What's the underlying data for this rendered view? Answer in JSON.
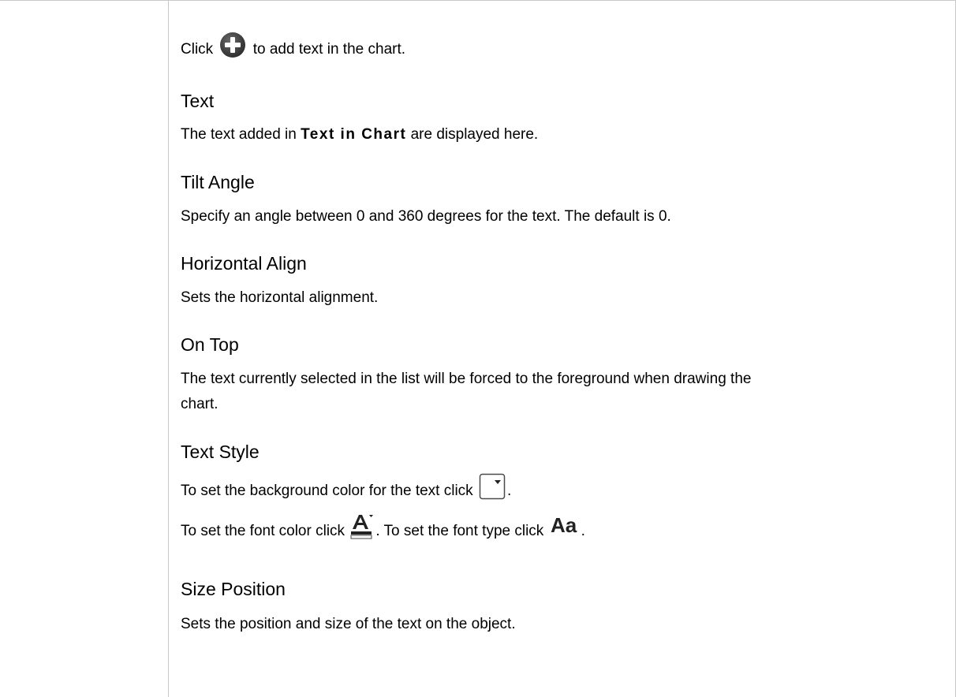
{
  "intro": {
    "before": "Click",
    "icon": "add-circle-icon",
    "after": "to add text in the chart."
  },
  "sections": {
    "text": {
      "heading": "Text",
      "body_before": "The text added in",
      "body_bold": "Text in Chart",
      "body_after": "are displayed here."
    },
    "tilt_angle": {
      "heading": "Tilt Angle",
      "body": "Specify an angle between 0 and 360 degrees for the text. The default is 0."
    },
    "horizontal_align": {
      "heading": "Horizontal Align",
      "body": "Sets the horizontal alignment."
    },
    "on_top": {
      "heading": "On Top",
      "body_line1": "The text currently selected in the list will be forced to the foreground when drawing the",
      "body_line2": "chart."
    },
    "text_style": {
      "heading": "Text Style",
      "line1_before": "To set the background color for the text click",
      "line1_after": ".",
      "line1_icon": "color-dropdown-icon",
      "line2_part1": "To set the font color click",
      "line2_icon1": "font-color-icon",
      "line2_part2": ". To set the font type click",
      "line2_icon2": "font-type-icon",
      "line2_icon2_text": "Aa",
      "line2_part3": "."
    },
    "size_position": {
      "heading": "Size Position",
      "body": "Sets the position and size of the text on the object."
    }
  },
  "colors": {
    "border": "#c9c9c9",
    "icon_dark": "#3d3d3d"
  }
}
